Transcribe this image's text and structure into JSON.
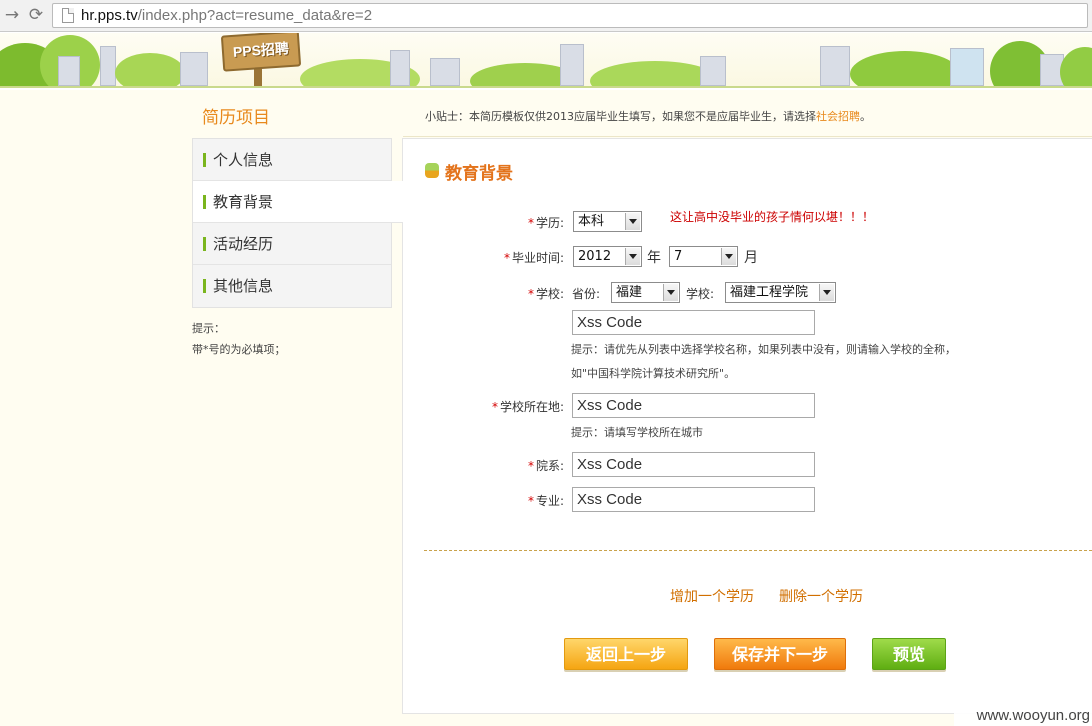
{
  "browser": {
    "url_host": "hr.pps.tv",
    "url_path": "/index.php?act=resume_data&re=2"
  },
  "banner": {
    "sign_text": "PPS招聘"
  },
  "sidebar": {
    "title": "简历项目",
    "items": [
      {
        "label": "个人信息",
        "active": false
      },
      {
        "label": "教育背景",
        "active": true
      },
      {
        "label": "活动经历",
        "active": false
      },
      {
        "label": "其他信息",
        "active": false
      }
    ],
    "hint_title": "提示：",
    "hint_text": "带*号的为必填项；"
  },
  "tip": {
    "text": "小贴士：本简历模板仅供2013应届毕业生填写，如果您不是应届毕业生，请选择",
    "link": "社会招聘",
    "end": "。"
  },
  "section": {
    "title": "教育背景",
    "warning": "这让高中没毕业的孩子情何以堪！！！"
  },
  "form": {
    "required_mark": "*",
    "degree": {
      "label": "学历:",
      "value": "本科"
    },
    "graduation": {
      "label": "毕业时间:",
      "year": "2012",
      "year_unit": "年",
      "month": "7",
      "month_unit": "月"
    },
    "school": {
      "label": "学校:",
      "province_label": "省份:",
      "province": "福建",
      "school_label": "学校:",
      "school_value": "福建工程学院",
      "input_value": "Xss  Code",
      "note1": "提示：请优先从列表中选择学校名称，如果列表中没有，则请输入学校的全称，",
      "note2": "如\"中国科学院计算技术研究所\"。"
    },
    "location": {
      "label": "学校所在地:",
      "value": "Xss  Code",
      "note": "提示：请填写学校所在城市"
    },
    "department": {
      "label": "院系:",
      "value": "Xss  Code"
    },
    "major": {
      "label": "专业:",
      "value": "Xss  Code"
    }
  },
  "actions": {
    "add": "增加一个学历",
    "remove": "删除一个学历",
    "back": "返回上一步",
    "save_next": "保存并下一步",
    "preview": "预览"
  },
  "watermark": "www.wooyun.org"
}
